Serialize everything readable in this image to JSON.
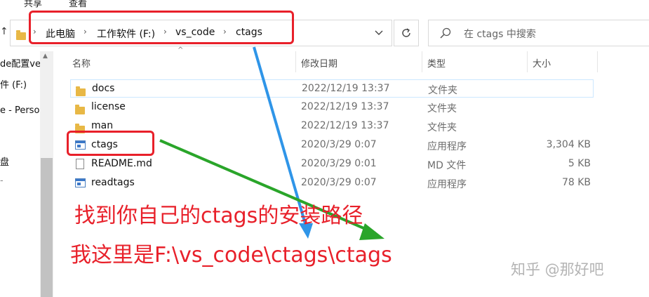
{
  "ribbon": {
    "share": "共享",
    "view": "查看"
  },
  "address_bar": {
    "crumbs": [
      "此电脑",
      "工作软件 (F:)",
      "vs_code",
      "ctags"
    ],
    "separator": "›",
    "dropdown_icon": "chevron-down-icon",
    "refresh_icon": "refresh-icon"
  },
  "search": {
    "placeholder": "在 ctags 中搜索",
    "icon": "search-icon"
  },
  "nav_pane": {
    "items": [
      "de配置ve",
      "件 (F:)",
      "e - Perso",
      "盘",
      "-"
    ]
  },
  "columns": {
    "name": "名称",
    "date": "修改日期",
    "type": "类型",
    "size": "大小"
  },
  "files": [
    {
      "name": "docs",
      "date": "2022/12/19 13:37",
      "type": "文件夹",
      "size": "",
      "icon": "folder-icon"
    },
    {
      "name": "license",
      "date": "2022/12/19 13:37",
      "type": "文件夹",
      "size": "",
      "icon": "folder-icon"
    },
    {
      "name": "man",
      "date": "2022/12/19 13:37",
      "type": "文件夹",
      "size": "",
      "icon": "folder-icon"
    },
    {
      "name": "ctags",
      "date": "2020/3/29 0:07",
      "type": "应用程序",
      "size": "3,304 KB",
      "icon": "application-icon"
    },
    {
      "name": "README.md",
      "date": "2020/3/29 0:01",
      "type": "MD 文件",
      "size": "5 KB",
      "icon": "document-icon"
    },
    {
      "name": "readtags",
      "date": "2020/3/29 0:07",
      "type": "应用程序",
      "size": "78 KB",
      "icon": "application-icon"
    }
  ],
  "annotations": {
    "line1": "找到你自己的ctags的安装路径",
    "line2": "我这里是F:\\vs_code\\ctags\\ctags",
    "color": "#e8202a",
    "arrow_blue": "#2f95e8",
    "arrow_green": "#2aa52a"
  },
  "watermark": "知乎 @那好吧"
}
